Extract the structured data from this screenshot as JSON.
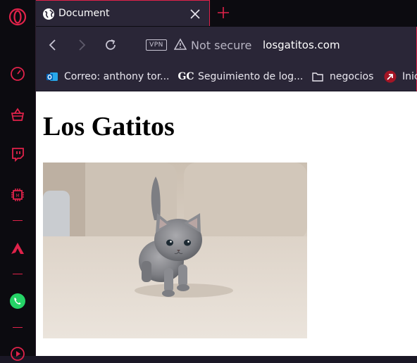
{
  "browser": {
    "tab": {
      "title": "Document"
    },
    "address_bar": {
      "vpn_label": "VPN",
      "security_text": "Not secure",
      "url": "losgatitos.com"
    },
    "bookmarks": [
      {
        "label": "Correo: anthony tor...",
        "icon": "outlook-icon"
      },
      {
        "label": "Seguimiento de log...",
        "icon_text": "GC"
      },
      {
        "label": "negocios",
        "icon": "folder-icon"
      },
      {
        "label": "Inic",
        "icon": "arrow-badge-icon"
      }
    ],
    "sidebar": {
      "items": [
        "opera-logo",
        "speed-dial-icon",
        "basket-icon",
        "twitch-icon",
        "chip-icon",
        "arrow-logo-icon",
        "whatsapp-icon",
        "player-icon"
      ]
    },
    "colors": {
      "accent": "#e0224a",
      "chrome": "#2a2637",
      "sidebar": "#0c0b10",
      "whatsapp": "#25d366"
    }
  },
  "page": {
    "heading": "Los Gatitos",
    "image_subject": "kitten"
  }
}
